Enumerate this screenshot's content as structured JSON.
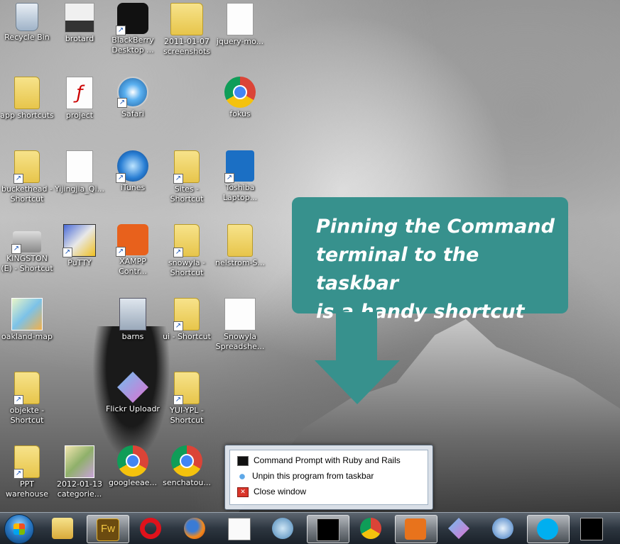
{
  "desktop_icons": [
    {
      "label": "Recycle Bin"
    },
    {
      "label": "brotard"
    },
    {
      "label": "BlackBerry Desktop ..."
    },
    {
      "label": "2011-01-07 screenshots"
    },
    {
      "label": "jquery-mo..."
    },
    {
      "label": "app shortcuts"
    },
    {
      "label": "project"
    },
    {
      "label": "Safari"
    },
    {
      "label": "fokus"
    },
    {
      "label": "buckethead - Shortcut"
    },
    {
      "label": "Yijingjia_Qi..."
    },
    {
      "label": "iTunes"
    },
    {
      "label": "Sites - Shortcut"
    },
    {
      "label": "Toshiba Laptop..."
    },
    {
      "label": "KINGSTON (E) - Shortcut"
    },
    {
      "label": "PuTTY"
    },
    {
      "label": "XAMPP Contr..."
    },
    {
      "label": "snowyla - Shortcut"
    },
    {
      "label": "nelstrom-S..."
    },
    {
      "label": "oakland-map"
    },
    {
      "label": "barns"
    },
    {
      "label": "ui - Shortcut"
    },
    {
      "label": "Snowyla Spreadshe..."
    },
    {
      "label": "objekte - Shortcut"
    },
    {
      "label": "Flickr Uploadr"
    },
    {
      "label": "YUI-YPL - Shortcut"
    },
    {
      "label": "PPT warehouse"
    },
    {
      "label": "2012-01-13 categorie..."
    },
    {
      "label": "googleeae..."
    },
    {
      "label": "senchatou..."
    }
  ],
  "callout": {
    "line1": "Pinning the Command",
    "line2": "terminal to the taskbar",
    "line3": "is a handy shortcut"
  },
  "jumplist": {
    "items": [
      {
        "label": "Command Prompt with Ruby and Rails"
      },
      {
        "label": "Unpin this program from taskbar"
      },
      {
        "label": "Close window"
      }
    ]
  },
  "taskbar": {
    "fireworks_label": "Fw"
  },
  "colors": {
    "callout": "#37918d",
    "taskbar": "#2d3640"
  }
}
